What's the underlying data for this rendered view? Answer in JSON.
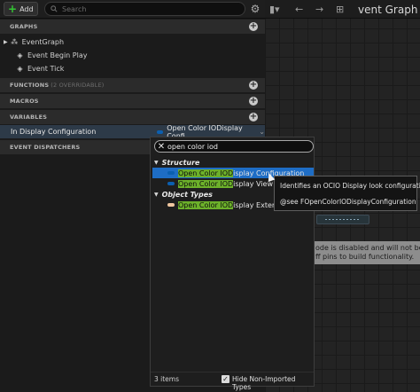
{
  "toolbar": {
    "add_label": "Add",
    "search_placeholder": "Search"
  },
  "sections": {
    "graphs": "GRAPHS",
    "functions": "FUNCTIONS",
    "functions_sub": "(2 OVERRIDABLE)",
    "macros": "MACROS",
    "variables": "VARIABLES",
    "event_dispatchers": "EVENT DISPATCHERS"
  },
  "graphs_tree": {
    "root": "EventGraph",
    "children": [
      "Event Begin Play",
      "Event Tick"
    ]
  },
  "variable": {
    "name": "In Display Configuration",
    "type_label": "Open Color IODisplay Confi"
  },
  "graph_panel": {
    "title": "vent Graph",
    "message_line1": "ode is disabled and will not be call",
    "message_line2": "ff pins to build functionality."
  },
  "picker": {
    "search_value": "open color iod",
    "categories": [
      {
        "label": "Structure",
        "items": [
          {
            "match": "Open Color IOD",
            "rest": "isplay Configuration",
            "selected": true
          },
          {
            "match": "Open Color IOD",
            "rest": "isplay View",
            "selected": false
          }
        ]
      },
      {
        "label": "Object Types",
        "items": [
          {
            "match": "Open Color IOD",
            "rest": "isplay Exter",
            "selected": false
          }
        ]
      }
    ],
    "item_count": "3 items",
    "hide_label": "Hide Non-Imported Types",
    "hide_checked": true
  },
  "tooltip": {
    "line1": "Identifies an OCIO Display look configuration",
    "line2": "@see FOpenColorIODisplayConfiguration"
  },
  "colors": {
    "struct_swatch": "#0b5fb0",
    "object_swatch": "#f0c7a0",
    "selection": "#1e6dc5",
    "match_highlight": "#6cb02a"
  }
}
